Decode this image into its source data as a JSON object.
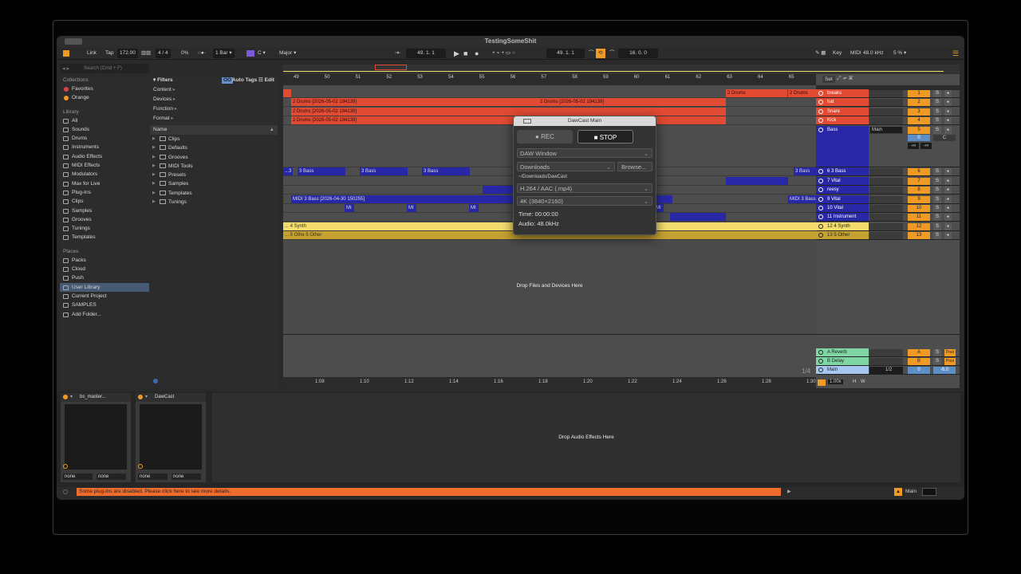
{
  "window": {
    "title": "TestingSomeShit"
  },
  "control_bar": {
    "link": "Link",
    "tap": "Tap",
    "tempo": "172.00",
    "signature": "4 / 4",
    "groove": "0%",
    "quantize": "1 Bar",
    "key": "C",
    "scale": "Major",
    "position": "49. 1. 1",
    "loop_start": "49. 1. 1",
    "loop_length": "16. 0. 0",
    "key_map": "Key",
    "midi_map": "MIDI",
    "sample_rate": "48.0 kHz",
    "cpu": "5 %"
  },
  "browser": {
    "search_placeholder": "Search (Cmd + F)",
    "collections_title": "Collections",
    "collections": [
      {
        "label": "Favorites",
        "color": "#e04040"
      },
      {
        "label": "Orange",
        "color": "#f09a26"
      }
    ],
    "library_title": "Library",
    "library": [
      "All",
      "Sounds",
      "Drums",
      "Instruments",
      "Audio Effects",
      "MIDI Effects",
      "Modulators",
      "Max for Live",
      "Plug-Ins",
      "Clips",
      "Samples",
      "Grooves",
      "Tunings",
      "Templates"
    ],
    "places_title": "Places",
    "places": [
      "Packs",
      "Cloud",
      "Push",
      "User Library",
      "Current Project",
      "SAMPLES",
      "Add Folder..."
    ],
    "selected_place": "User Library"
  },
  "filters": {
    "title": "Filters",
    "auto_tags_chip": "OO",
    "auto_tags": "Auto Tags",
    "edit": "Edit",
    "items": [
      "Content",
      "Devices",
      "Function",
      "Format"
    ],
    "name_header": "Name",
    "folders": [
      "Clips",
      "Defaults",
      "Grooves",
      "MIDI Tools",
      "Presets",
      "Samples",
      "Templates",
      "Tunings"
    ]
  },
  "arrangement": {
    "bars": [
      "49",
      "50",
      "51",
      "52",
      "53",
      "54",
      "55",
      "56",
      "57",
      "58",
      "59",
      "60",
      "61",
      "62",
      "63",
      "64",
      "65"
    ],
    "times": [
      "1:08",
      "1:10",
      "1:12",
      "1:14",
      "1:16",
      "1:18",
      "1:20",
      "1:22",
      "1:24",
      "1:26",
      "1:28",
      "1:30"
    ],
    "set_label": "Set",
    "drop_text": "Drop Files and Devices Here",
    "zoom": "1/4",
    "scale": "1.00x",
    "h": "H",
    "w": "W",
    "clip_labels": {
      "drums": "2 Drums [2026-05-02 194139]",
      "drums_short": "2 Drums",
      "bass": "3 Bass",
      "bass_short": "...3",
      "midi_bass": "MIDI 3 Bass [2026-04-30 150255]",
      "midi_short": "MI",
      "synth": "... 4 Synth",
      "other": "... 5 Othe 5 Other"
    }
  },
  "tracks": [
    {
      "name": "breaks",
      "num": "1",
      "color": "#e14a33"
    },
    {
      "name": "hat",
      "num": "2",
      "color": "#e14a33"
    },
    {
      "name": "Snare",
      "num": "3",
      "color": "#e14a33"
    },
    {
      "name": "Kick",
      "num": "4",
      "color": "#e14a33"
    },
    {
      "name": "Bass",
      "num": "5",
      "color": "#2828a6"
    },
    {
      "name": "6 3 Bass",
      "num": "6",
      "color": "#2828a6"
    },
    {
      "name": "7 Vital",
      "num": "7",
      "color": "#2828a6"
    },
    {
      "name": "reesy",
      "num": "8",
      "color": "#2828a6"
    },
    {
      "name": "9 Vital",
      "num": "9",
      "color": "#2828a6"
    },
    {
      "name": "10 Vital",
      "num": "10",
      "color": "#2828a6"
    },
    {
      "name": "11 Instrument",
      "num": "11",
      "color": "#2828a6"
    },
    {
      "name": "12 4 Synth",
      "num": "12",
      "color": "#f3dc6d"
    },
    {
      "name": "13 5 Other",
      "num": "13",
      "color": "#c4a131"
    }
  ],
  "bass_track": {
    "routing": "Main",
    "vol": "0",
    "pan": "C",
    "inf1": "-∞",
    "inf2": "-∞"
  },
  "returns": [
    {
      "name": "A Reverb",
      "letter": "A",
      "post": "Post"
    },
    {
      "name": "B Delay",
      "letter": "B",
      "post": "Post"
    }
  ],
  "main": {
    "name": "Main",
    "routing": "1/2",
    "vol": "0",
    "db": "-6.0"
  },
  "solo": "S",
  "dawcast": {
    "title": "DawCast Main",
    "rec": "● REC",
    "stop": "■ STOP",
    "source": "DAW Window",
    "folder": "Downloads",
    "browse": "Browse...",
    "path": "~/Downloads/DawCast",
    "codec": "H.264 / AAC  (.mp4)",
    "resolution": "4K  (3840×2160)",
    "time": "Time: 00:00:00",
    "audio": "Audio: 48.0kHz"
  },
  "devices": {
    "drop_text": "Drop Audio Effects Here",
    "dev1": {
      "name": "bs_master...",
      "sel1": "none",
      "sel2": "none"
    },
    "dev2": {
      "name": "DawCast",
      "sel1": "none",
      "sel2": "none"
    }
  },
  "status": {
    "warning": "Some plug-ins are disabled. Please click here to see more details.",
    "track": "Main"
  }
}
